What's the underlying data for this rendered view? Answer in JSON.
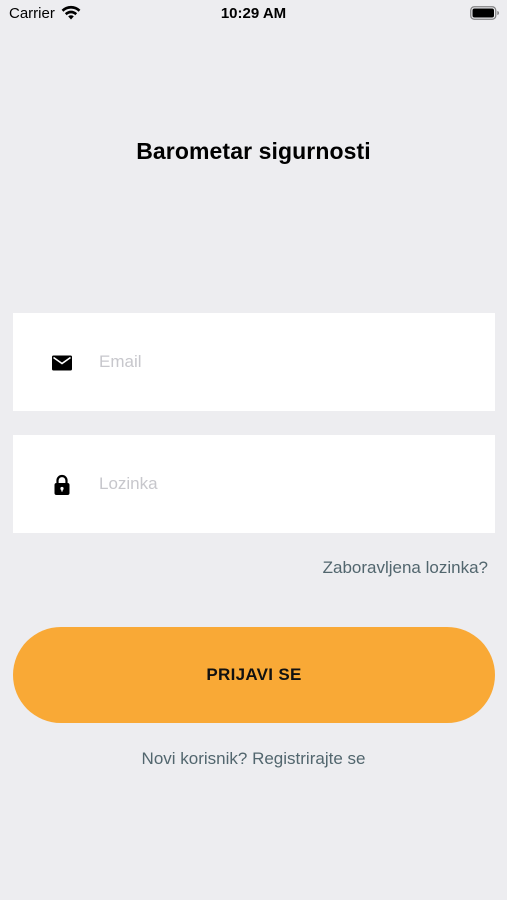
{
  "status_bar": {
    "carrier": "Carrier",
    "time": "10:29 AM"
  },
  "title": "Barometar sigurnosti",
  "email_field": {
    "icon": "mail-icon",
    "placeholder": "Email",
    "value": ""
  },
  "password_field": {
    "icon": "lock-icon",
    "placeholder": "Lozinka",
    "value": ""
  },
  "forgot_password": "Zaboravljena lozinka?",
  "login_button": "PRIJAVI SE",
  "register_link": "Novi korisnik? Registrirajte se",
  "colors": {
    "background": "#ededf0",
    "accent": "#f9a936",
    "link": "#52666e"
  }
}
